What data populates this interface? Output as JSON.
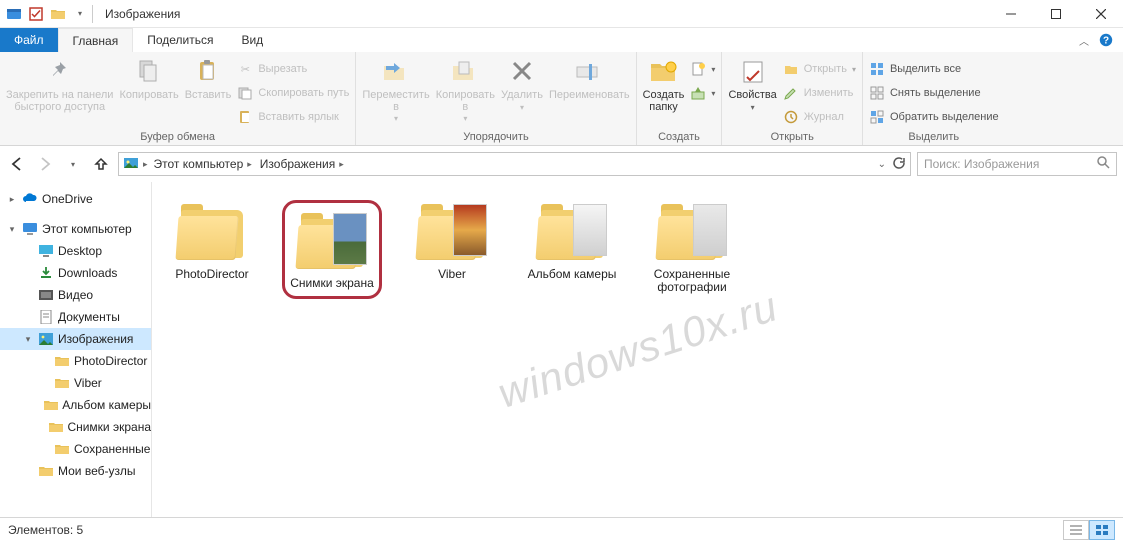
{
  "title": "Изображения",
  "watermark": "windows10x.ru",
  "tabs": {
    "file": "Файл",
    "home": "Главная",
    "share": "Поделиться",
    "view": "Вид"
  },
  "ribbon": {
    "clipboard": {
      "label": "Буфер обмена",
      "pin": "Закрепить на панели\nбыстрого доступа",
      "copy": "Копировать",
      "paste": "Вставить",
      "cut": "Вырезать",
      "copypath": "Скопировать путь",
      "pasteshortcut": "Вставить ярлык"
    },
    "organize": {
      "label": "Упорядочить",
      "move": "Переместить\nв",
      "copyto": "Копировать\nв",
      "delete": "Удалить",
      "rename": "Переименовать"
    },
    "new": {
      "label": "Создать",
      "newfolder": "Создать\nпапку",
      "newitem": "",
      "easyaccess": ""
    },
    "open": {
      "label": "Открыть",
      "props": "Свойства",
      "open": "Открыть",
      "edit": "Изменить",
      "history": "Журнал"
    },
    "select": {
      "label": "Выделить",
      "all": "Выделить все",
      "none": "Снять выделение",
      "invert": "Обратить выделение"
    }
  },
  "breadcrumbs": [
    "Этот компьютер",
    "Изображения"
  ],
  "search_placeholder": "Поиск: Изображения",
  "nav": {
    "onedrive": "OneDrive",
    "thispc": "Этот компьютер",
    "desktop": "Desktop",
    "downloads": "Downloads",
    "videos": "Видео",
    "documents": "Документы",
    "pictures": "Изображения",
    "photodirector": "PhotoDirector",
    "viber": "Viber",
    "camera": "Альбом камеры",
    "screenshots": "Снимки экрана",
    "saved": "Сохраненные",
    "websites": "Мои веб-узлы"
  },
  "items": [
    {
      "name": "PhotoDirector"
    },
    {
      "name": "Снимки экрана"
    },
    {
      "name": "Viber"
    },
    {
      "name": "Альбом камеры"
    },
    {
      "name": "Сохраненные фотографии"
    }
  ],
  "status": {
    "count_label": "Элементов:",
    "count": "5"
  }
}
